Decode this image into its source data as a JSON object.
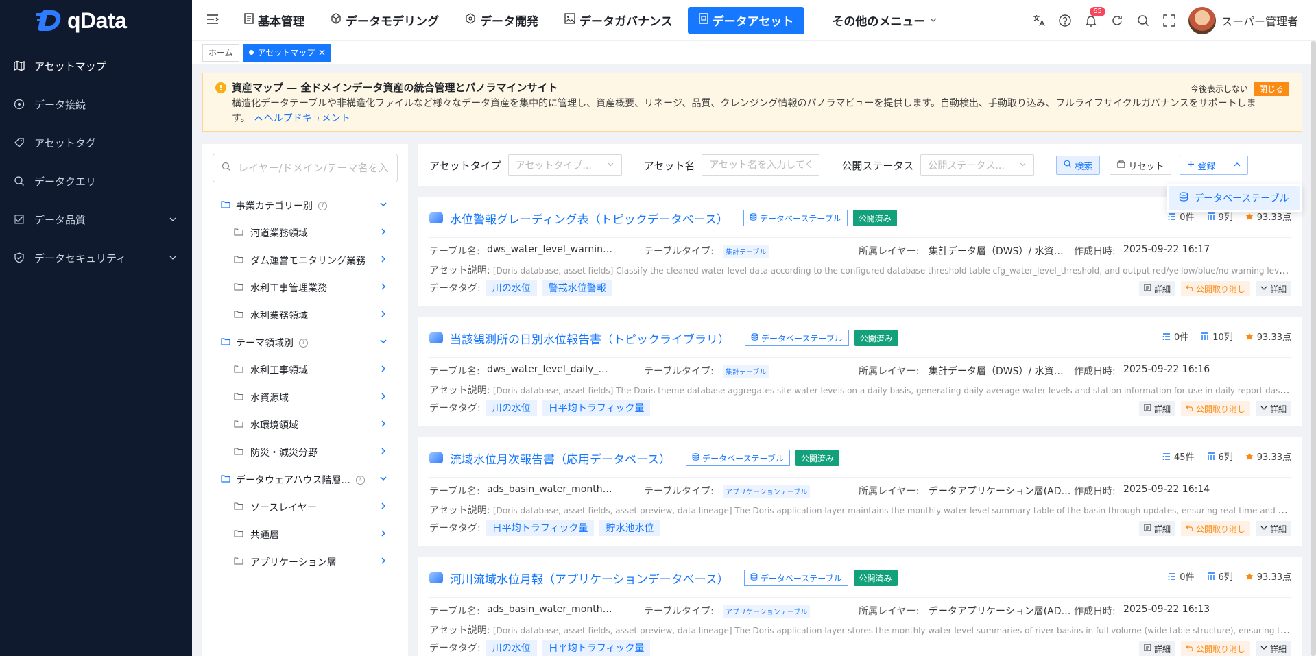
{
  "brand": {
    "name": "qData"
  },
  "sidebar": {
    "items": [
      {
        "label": "アセットマップ",
        "icon": "map-icon",
        "active": true
      },
      {
        "label": "データ接続",
        "icon": "target-icon"
      },
      {
        "label": "アセットタグ",
        "icon": "tag-icon"
      },
      {
        "label": "データクエリ",
        "icon": "query-icon"
      },
      {
        "label": "データ品質",
        "icon": "quality-icon",
        "expandable": true
      },
      {
        "label": "データセキュリティ",
        "icon": "shield-icon",
        "expandable": true
      }
    ]
  },
  "topbar": {
    "menu": [
      {
        "label": "基本管理",
        "icon": "doc-icon"
      },
      {
        "label": "データモデリング",
        "icon": "cube-icon"
      },
      {
        "label": "データ開発",
        "icon": "hex-icon"
      },
      {
        "label": "データガバナンス",
        "icon": "image-icon"
      },
      {
        "label": "データアセット",
        "icon": "asset-icon",
        "active": true
      },
      {
        "label": "その他のメニュー",
        "icon": "chevron-down-icon"
      }
    ],
    "notification_count": "65",
    "user": "スーパー管理者"
  },
  "tabs": {
    "home": "ホーム",
    "current": "アセットマップ"
  },
  "notice": {
    "title": "資産マップ — 全ドメインデータ資産の統合管理とパノラマインサイト",
    "text": "構造化データテーブルや非構造化ファイルなど様々なデータ資産を集中的に管理し、資産概要、リネージ、品質、クレンジング情報のパノラマビューを提供します。自動検出、手動取り込み、フルライフサイクルガバナンスをサポートします。",
    "link": "ヘルプドキュメント",
    "hide": "今後表示しない",
    "close": "閉じる"
  },
  "tree": {
    "search_placeholder": "レイヤー/ドメイン/テーマ名を入力",
    "groups": [
      {
        "label": "事業カテゴリー別",
        "children": [
          "河道業務領域",
          "ダム運営モニタリング業務",
          "水利工事管理業務",
          "水利業務領域"
        ]
      },
      {
        "label": "テーマ領域別",
        "children": [
          "水利工事領域",
          "水資源域",
          "水環境領域",
          "防災・減災分野"
        ]
      },
      {
        "label": "データウェアハウス階層...",
        "children": [
          "ソースレイヤー",
          "共通層",
          "アプリケーション層"
        ]
      }
    ]
  },
  "filters": {
    "asset_type_label": "アセットタイプ",
    "asset_type_placeholder": "アセットタイプ...",
    "asset_name_label": "アセット名",
    "asset_name_placeholder": "アセット名を入力してく",
    "status_label": "公開ステータス",
    "status_placeholder": "公開ステータス...",
    "search": "検索",
    "reset": "リセット",
    "register": "登録",
    "dropdown_item": "データベーステーブル"
  },
  "labels": {
    "table_name": "テーブル名:",
    "table_type": "テーブルタイプ:",
    "layer": "所属レイヤー:",
    "created": "作成日時:",
    "desc": "アセット説明:",
    "tags": "データタグ:",
    "db_table": "データベーステーブル",
    "published": "公開済み",
    "detail": "詳細",
    "unpublish": "公開取り消し",
    "expand": "詳細"
  },
  "assets": [
    {
      "title": "水位警報グレーディング表（トピックデータベース）",
      "records": "0件",
      "columns": "9列",
      "score": "93.33点",
      "table_name": "dws_water_level_warning_lvl",
      "table_type": "集計テーブル",
      "layer": "集計データ層（DWS）/ 水資源...",
      "created": "2025-09-22 16:17",
      "desc": "[Doris database, asset fields] Classify the cleaned water level data according to the configured database threshold table cfg_water_level_threshold, and output red/yellow/blue/no warning levels for use in the warning module.",
      "tags": [
        "川の水位",
        "警戒水位警報"
      ]
    },
    {
      "title": "当該観測所の日別水位報告書（トピックライブラリ）",
      "records": "0件",
      "columns": "10列",
      "score": "93.33点",
      "table_name": "dws_water_level_daily_agg",
      "table_type": "集計テーブル",
      "layer": "集計データ層（DWS）/ 水資源...",
      "created": "2025-09-22 16:16",
      "desc": "[Doris database, asset fields] The Doris theme database aggregates site water levels on a daily basis, generating daily average water levels and station information for use in daily report dashboards and daily statistics.",
      "tags": [
        "川の水位",
        "日平均トラフィック量"
      ]
    },
    {
      "title": "流域水位月次報告書（応用データベース）",
      "records": "45件",
      "columns": "6列",
      "score": "93.33点",
      "table_name": "ads_basin_water_month_report_w...",
      "table_type": "アプリケーションテーブル",
      "layer": "データアプリケーション層(ADS...",
      "created": "2025-09-22 16:14",
      "desc": "[Doris database, asset fields, asset preview, data lineage] The Doris application layer maintains the monthly water level summary table of the basin through updates, ensuring real-time and accurate data to serve dispatch.",
      "tags": [
        "日平均トラフィック量",
        "貯水池水位"
      ]
    },
    {
      "title": "河川流域水位月報（アプリケーションデータベース）",
      "records": "0件",
      "columns": "6列",
      "score": "93.33点",
      "table_name": "ads_basin_water_month_report_w...",
      "table_type": "アプリケーションテーブル",
      "layer": "データアプリケーション層(ADS...",
      "created": "2025-09-22 16:13",
      "desc": "[Doris database, asset fields, asset preview, data lineage] The Doris application layer stores the monthly water level summaries of river basins in full volume (wide table structure), ensuring the completeness of statistics.",
      "tags": [
        "川の水位",
        "日平均トラフィック量"
      ]
    }
  ]
}
